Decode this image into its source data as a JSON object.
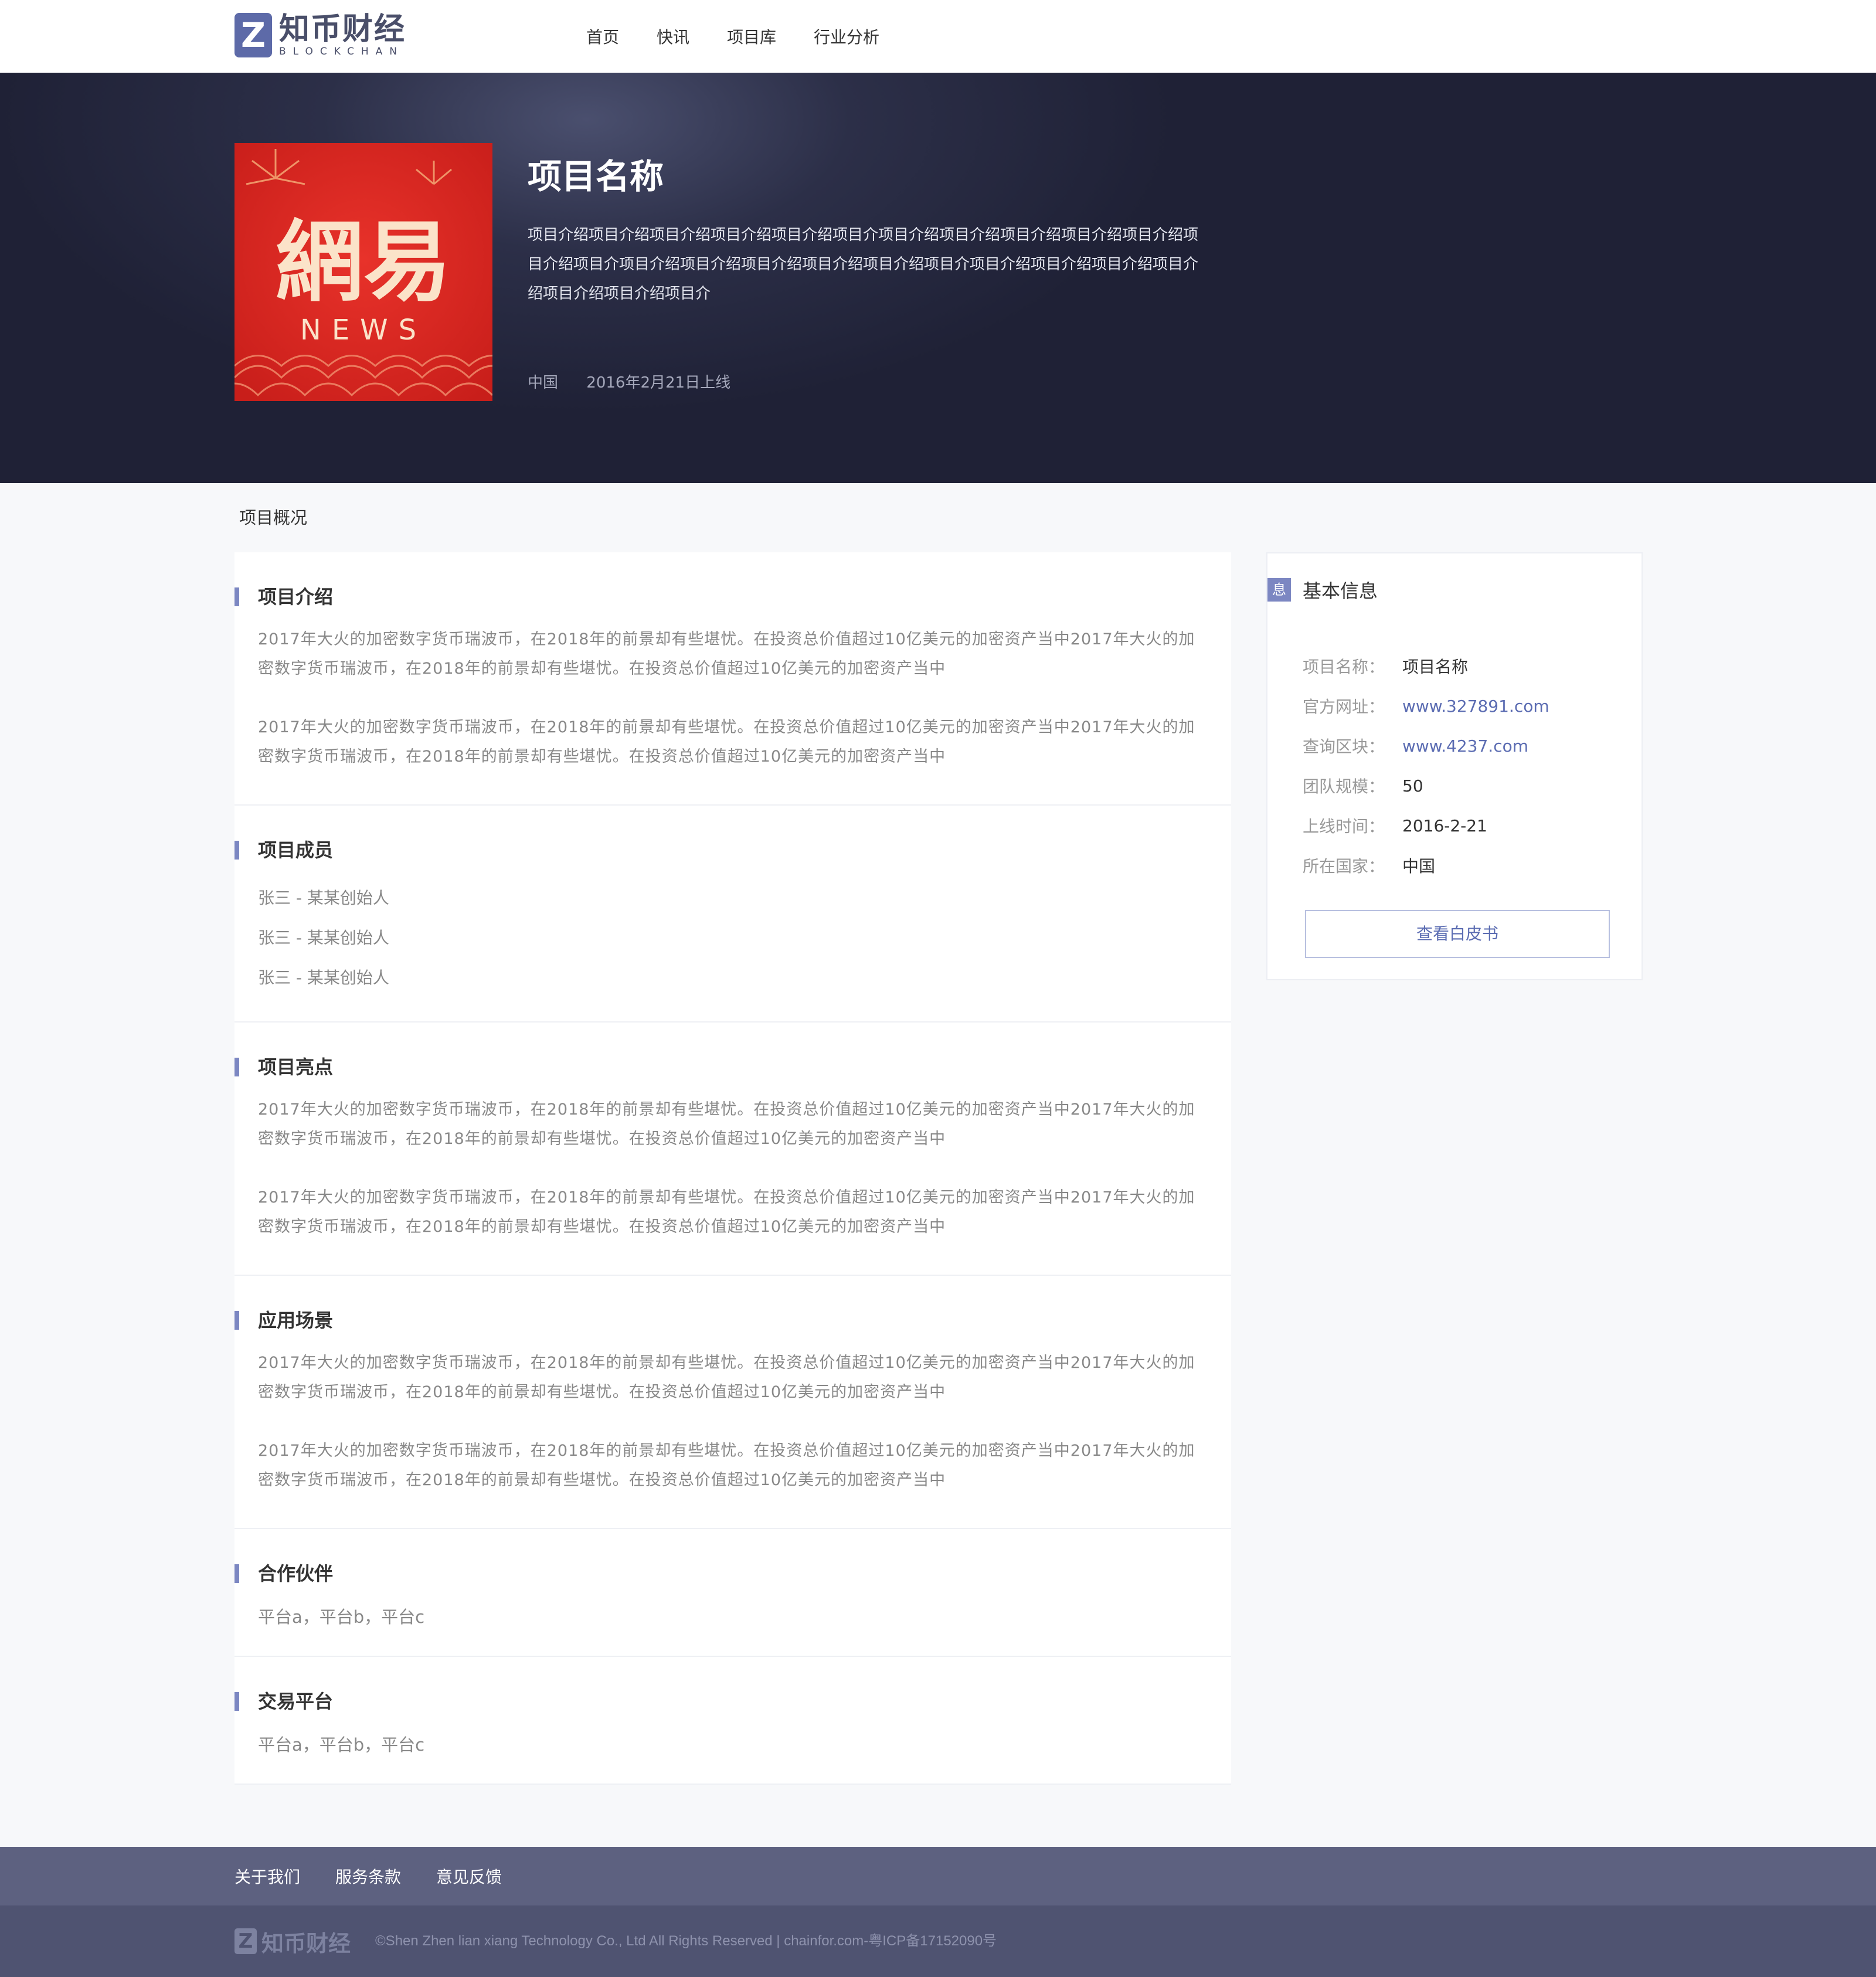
{
  "header": {
    "logo_cn": "知币财经",
    "logo_en": "BLOCKCHAN",
    "nav": [
      "首页",
      "快讯",
      "项目库",
      "行业分析"
    ]
  },
  "hero": {
    "logo_main": "網易",
    "logo_sub": "NEWS",
    "title": "项目名称",
    "description": "项目介绍项目介绍项目介绍项目介绍项目介绍项目介项目介绍项目介绍项目介绍项目介绍项目介绍项目介绍项目介项目介绍项目介绍项目介绍项目介绍项目介绍项目介项目介绍项目介绍项目介绍项目介绍项目介绍项目介绍项目介",
    "country": "中国",
    "launch": "2016年2月21日上线"
  },
  "overview_label": "项目概况",
  "sections": {
    "intro": {
      "title": "项目介绍",
      "paragraphs": [
        "2017年大火的加密数字货币瑞波币，在2018年的前景却有些堪忧。在投资总价值超过10亿美元的加密资产当中2017年大火的加密数字货币瑞波币，在2018年的前景却有些堪忧。在投资总价值超过10亿美元的加密资产当中",
        "2017年大火的加密数字货币瑞波币，在2018年的前景却有些堪忧。在投资总价值超过10亿美元的加密资产当中2017年大火的加密数字货币瑞波币，在2018年的前景却有些堪忧。在投资总价值超过10亿美元的加密资产当中"
      ]
    },
    "members": {
      "title": "项目成员",
      "items": [
        "张三 - 某某创始人",
        "张三 - 某某创始人",
        "张三 - 某某创始人"
      ]
    },
    "highlights": {
      "title": "项目亮点",
      "paragraphs": [
        "2017年大火的加密数字货币瑞波币，在2018年的前景却有些堪忧。在投资总价值超过10亿美元的加密资产当中2017年大火的加密数字货币瑞波币，在2018年的前景却有些堪忧。在投资总价值超过10亿美元的加密资产当中",
        "2017年大火的加密数字货币瑞波币，在2018年的前景却有些堪忧。在投资总价值超过10亿美元的加密资产当中2017年大火的加密数字货币瑞波币，在2018年的前景却有些堪忧。在投资总价值超过10亿美元的加密资产当中"
      ]
    },
    "scenarios": {
      "title": "应用场景",
      "paragraphs": [
        "2017年大火的加密数字货币瑞波币，在2018年的前景却有些堪忧。在投资总价值超过10亿美元的加密资产当中2017年大火的加密数字货币瑞波币，在2018年的前景却有些堪忧。在投资总价值超过10亿美元的加密资产当中",
        "2017年大火的加密数字货币瑞波币，在2018年的前景却有些堪忧。在投资总价值超过10亿美元的加密资产当中2017年大火的加密数字货币瑞波币，在2018年的前景却有些堪忧。在投资总价值超过10亿美元的加密资产当中"
      ]
    },
    "partners": {
      "title": "合作伙伴",
      "text": "平台a，平台b，平台c"
    },
    "exchanges": {
      "title": "交易平台",
      "text": "平台a，平台b，平台c"
    }
  },
  "side": {
    "badge": "息",
    "title": "基本信息",
    "rows": [
      {
        "key": "项目名称：",
        "value": "项目名称"
      },
      {
        "key": "官方网址：",
        "value": "www.327891.com"
      },
      {
        "key": "查询区块：",
        "value": "www.4237.com"
      },
      {
        "key": "团队规模：",
        "value": "50"
      },
      {
        "key": "上线时间：",
        "value": "2016-2-21"
      },
      {
        "key": "所在国家：",
        "value": "中国"
      }
    ],
    "whitepaper_button": "查看白皮书"
  },
  "footer": {
    "links": [
      "关于我们",
      "服务条款",
      "意见反馈"
    ],
    "brand": "知币财经",
    "copyright": "©Shen Zhen lian xiang Technology Co., Ltd All Rights Reserved | chainfor.com-粤ICP备17152090号"
  },
  "colors": {
    "accent": "#7c87c2",
    "link": "#5b6cb2",
    "hero_bg": "#22253a",
    "footer_links_bg": "#5d6180",
    "footer_bottom_bg": "#4f5371"
  },
  "icons": [
    "logo-z-icon",
    "info-badge-icon"
  ]
}
